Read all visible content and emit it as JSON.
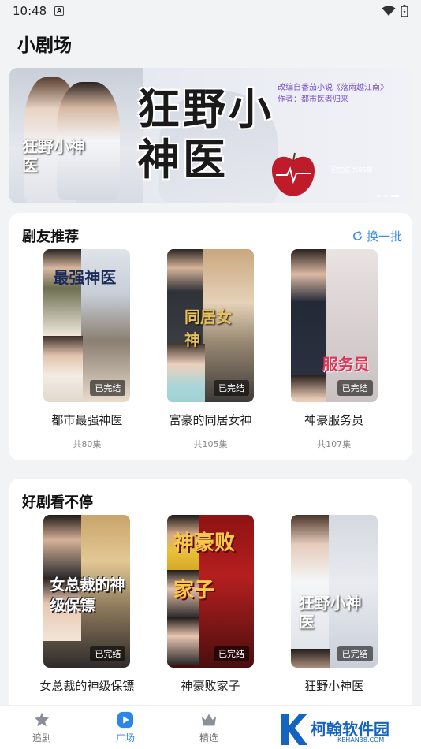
{
  "status_bar": {
    "time": "10:48",
    "notification_letter": "A"
  },
  "page": {
    "title": "小剧场"
  },
  "banner": {
    "title_big": "狂野小神医",
    "title_small": "狂野小神医",
    "tag_line_1": "改编自番茄小说《落雨越江南》",
    "tag_line_2": "作者：都市医者归来",
    "status_note": "已完结 共85集",
    "colors": {
      "accent": "#7b52c9"
    }
  },
  "section_recommend": {
    "title": "剧友推荐",
    "refresh_label": "换一批",
    "items": [
      {
        "name": "都市最强神医",
        "episodes": "共80集",
        "status": "已完结",
        "poster_text": "最强神医"
      },
      {
        "name": "富豪的同居女神",
        "episodes": "共105集",
        "status": "已完结",
        "poster_text": "同居女神"
      },
      {
        "name": "神豪服务员",
        "episodes": "共107集",
        "status": "已完结",
        "poster_text": "服务员"
      }
    ]
  },
  "section_nonstop": {
    "title": "好剧看不停",
    "items": [
      {
        "name": "女总裁的神级保镖",
        "status": "已完结",
        "poster_text": "女总裁的神级保镖"
      },
      {
        "name": "神豪败家子",
        "status": "已完结",
        "poster_text": "神豪败家子"
      },
      {
        "name": "狂野小神医",
        "status": "已完结",
        "poster_text": "狂野小神医"
      }
    ]
  },
  "bottom_nav": {
    "items": [
      {
        "label": "追剧",
        "icon": "star-icon",
        "active": false
      },
      {
        "label": "广场",
        "icon": "play-icon",
        "active": true
      },
      {
        "label": "精选",
        "icon": "crown-icon",
        "active": false
      }
    ]
  },
  "watermark": {
    "text": "柯翰软件园",
    "sub": "KEHAN38.COM"
  }
}
